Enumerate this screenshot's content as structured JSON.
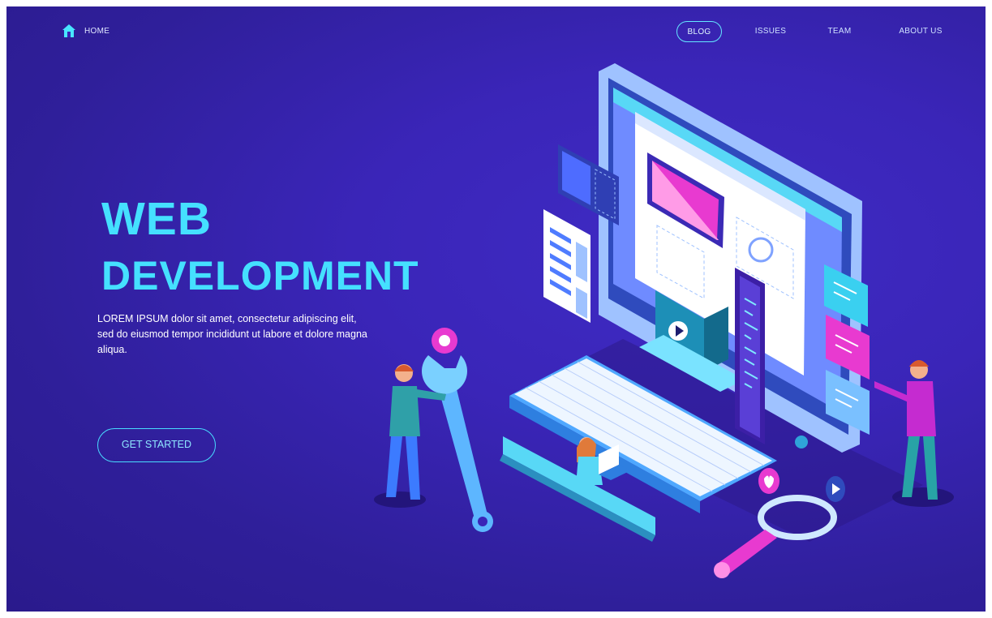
{
  "nav": {
    "home_label": "HOME",
    "items": [
      {
        "label": "BLOG",
        "active": true
      },
      {
        "label": "ISSUES",
        "active": false
      },
      {
        "label": "TEAM",
        "active": false
      },
      {
        "label": "ABOUT US",
        "active": false
      }
    ]
  },
  "hero": {
    "title_line1": "WEB",
    "title_line2": "DEVELOPMENT",
    "description": "LOREM IPSUM dolor sit amet, consectetur adipiscing elit, sed do eiusmod tempor incididunt ut labore et dolore magna aliqua.",
    "cta_label": "GET STARTED"
  },
  "colors": {
    "background": "#3a25b8",
    "title": "#45e0ff",
    "accent_cyan": "#48dcff",
    "accent_magenta": "#e83ad0"
  },
  "icons": [
    "home-icon",
    "gear-icon",
    "play-icon",
    "heart-icon",
    "magnifier-icon"
  ]
}
